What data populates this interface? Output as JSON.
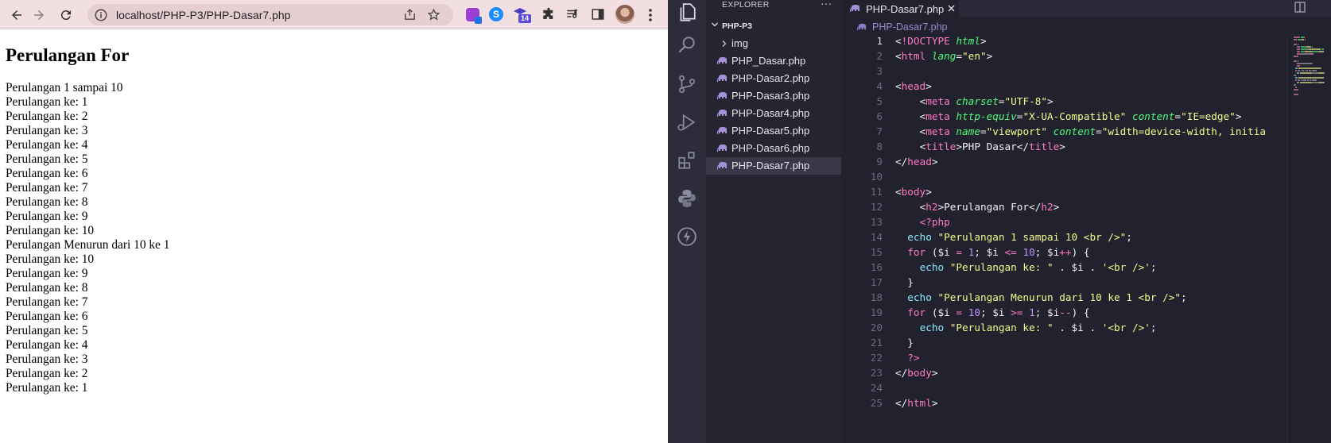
{
  "browser": {
    "url": "localhost/PHP-P3/PHP-Dasar7.php",
    "extension_badge": "14",
    "page": {
      "heading": "Perulangan For",
      "lines": [
        "Perulangan 1 sampai 10",
        "Perulangan ke: 1",
        "Perulangan ke: 2",
        "Perulangan ke: 3",
        "Perulangan ke: 4",
        "Perulangan ke: 5",
        "Perulangan ke: 6",
        "Perulangan ke: 7",
        "Perulangan ke: 8",
        "Perulangan ke: 9",
        "Perulangan ke: 10",
        "Perulangan Menurun dari 10 ke 1",
        "Perulangan ke: 10",
        "Perulangan ke: 9",
        "Perulangan ke: 8",
        "Perulangan ke: 7",
        "Perulangan ke: 6",
        "Perulangan ke: 5",
        "Perulangan ke: 4",
        "Perulangan ke: 3",
        "Perulangan ke: 2",
        "Perulangan ke: 1"
      ]
    }
  },
  "vscode": {
    "explorer_title": "EXPLORER",
    "explorer_more": "···",
    "project": "PHP-P3",
    "tree": [
      {
        "label": "img",
        "type": "folder"
      },
      {
        "label": "PHP_Dasar.php",
        "type": "php"
      },
      {
        "label": "PHP-Dasar2.php",
        "type": "php"
      },
      {
        "label": "PHP-Dasar3.php",
        "type": "php"
      },
      {
        "label": "PHP-Dasar4.php",
        "type": "php"
      },
      {
        "label": "PHP-Dasar5.php",
        "type": "php"
      },
      {
        "label": "PHP-Dasar6.php",
        "type": "php"
      },
      {
        "label": "PHP-Dasar7.php",
        "type": "php",
        "selected": true
      }
    ],
    "tab_label": "PHP-Dasar7.php",
    "breadcrumb": "PHP-Dasar7.php",
    "current_line": 1,
    "code_lines": [
      {
        "n": "1",
        "tokens": [
          [
            "pun",
            "<"
          ],
          [
            "bang",
            "!"
          ],
          [
            "tag",
            "DOCTYPE"
          ],
          [
            "txt",
            " "
          ],
          [
            "attr",
            "html"
          ],
          [
            "pun",
            ">"
          ]
        ]
      },
      {
        "n": "2",
        "tokens": [
          [
            "pun",
            "<"
          ],
          [
            "tag",
            "html"
          ],
          [
            "txt",
            " "
          ],
          [
            "attr",
            "lang"
          ],
          [
            "pun",
            "="
          ],
          [
            "str",
            "\"en\""
          ],
          [
            "pun",
            ">"
          ]
        ]
      },
      {
        "n": "3",
        "tokens": []
      },
      {
        "n": "4",
        "tokens": [
          [
            "pun",
            "<"
          ],
          [
            "tag",
            "head"
          ],
          [
            "pun",
            ">"
          ]
        ]
      },
      {
        "n": "5",
        "tokens": [
          [
            "txt",
            "    "
          ],
          [
            "pun",
            "<"
          ],
          [
            "tag",
            "meta"
          ],
          [
            "txt",
            " "
          ],
          [
            "attr",
            "charset"
          ],
          [
            "pun",
            "="
          ],
          [
            "str",
            "\"UTF-8\""
          ],
          [
            "pun",
            ">"
          ]
        ]
      },
      {
        "n": "6",
        "tokens": [
          [
            "txt",
            "    "
          ],
          [
            "pun",
            "<"
          ],
          [
            "tag",
            "meta"
          ],
          [
            "txt",
            " "
          ],
          [
            "attr",
            "http-equiv"
          ],
          [
            "pun",
            "="
          ],
          [
            "str",
            "\"X-UA-Compatible\""
          ],
          [
            "txt",
            " "
          ],
          [
            "attr",
            "content"
          ],
          [
            "pun",
            "="
          ],
          [
            "str",
            "\"IE=edge\""
          ],
          [
            "pun",
            ">"
          ]
        ]
      },
      {
        "n": "7",
        "tokens": [
          [
            "txt",
            "    "
          ],
          [
            "pun",
            "<"
          ],
          [
            "tag",
            "meta"
          ],
          [
            "txt",
            " "
          ],
          [
            "attr",
            "name"
          ],
          [
            "pun",
            "="
          ],
          [
            "str",
            "\"viewport\""
          ],
          [
            "txt",
            " "
          ],
          [
            "attr",
            "content"
          ],
          [
            "pun",
            "="
          ],
          [
            "str",
            "\"width=device-width, initia"
          ]
        ]
      },
      {
        "n": "8",
        "tokens": [
          [
            "txt",
            "    "
          ],
          [
            "pun",
            "<"
          ],
          [
            "tag",
            "title"
          ],
          [
            "pun",
            ">"
          ],
          [
            "txt",
            "PHP Dasar"
          ],
          [
            "pun",
            "</"
          ],
          [
            "tag",
            "title"
          ],
          [
            "pun",
            ">"
          ]
        ]
      },
      {
        "n": "9",
        "tokens": [
          [
            "pun",
            "</"
          ],
          [
            "tag",
            "head"
          ],
          [
            "pun",
            ">"
          ]
        ]
      },
      {
        "n": "10",
        "tokens": []
      },
      {
        "n": "11",
        "tokens": [
          [
            "pun",
            "<"
          ],
          [
            "tag",
            "body"
          ],
          [
            "pun",
            ">"
          ]
        ]
      },
      {
        "n": "12",
        "tokens": [
          [
            "txt",
            "    "
          ],
          [
            "pun",
            "<"
          ],
          [
            "tag",
            "h2"
          ],
          [
            "pun",
            ">"
          ],
          [
            "txt",
            "Perulangan For"
          ],
          [
            "pun",
            "</"
          ],
          [
            "tag",
            "h2"
          ],
          [
            "pun",
            ">"
          ]
        ]
      },
      {
        "n": "13",
        "tokens": [
          [
            "txt",
            "    "
          ],
          [
            "kw",
            "<?php"
          ]
        ]
      },
      {
        "n": "14",
        "tokens": [
          [
            "txt",
            "  "
          ],
          [
            "fn",
            "echo"
          ],
          [
            "txt",
            " "
          ],
          [
            "str",
            "\"Perulangan 1 sampai 10 <br />\""
          ],
          [
            "pun",
            ";"
          ]
        ]
      },
      {
        "n": "15",
        "tokens": [
          [
            "txt",
            "  "
          ],
          [
            "kw",
            "for"
          ],
          [
            "txt",
            " ("
          ],
          [
            "var",
            "$i"
          ],
          [
            "txt",
            " "
          ],
          [
            "op",
            "="
          ],
          [
            "txt",
            " "
          ],
          [
            "num",
            "1"
          ],
          [
            "pun",
            ";"
          ],
          [
            "txt",
            " "
          ],
          [
            "var",
            "$i"
          ],
          [
            "txt",
            " "
          ],
          [
            "op",
            "<="
          ],
          [
            "txt",
            " "
          ],
          [
            "num",
            "10"
          ],
          [
            "pun",
            ";"
          ],
          [
            "txt",
            " "
          ],
          [
            "var",
            "$i"
          ],
          [
            "op",
            "++"
          ],
          [
            "txt",
            ") {"
          ]
        ]
      },
      {
        "n": "16",
        "tokens": [
          [
            "txt",
            "    "
          ],
          [
            "fn",
            "echo"
          ],
          [
            "txt",
            " "
          ],
          [
            "str",
            "\"Perulangan ke: \""
          ],
          [
            "txt",
            " . "
          ],
          [
            "var",
            "$i"
          ],
          [
            "txt",
            " . "
          ],
          [
            "str",
            "'<br />'"
          ],
          [
            "pun",
            ";"
          ]
        ]
      },
      {
        "n": "17",
        "tokens": [
          [
            "txt",
            "  }"
          ]
        ]
      },
      {
        "n": "18",
        "tokens": [
          [
            "txt",
            "  "
          ],
          [
            "fn",
            "echo"
          ],
          [
            "txt",
            " "
          ],
          [
            "str",
            "\"Perulangan Menurun dari 10 ke 1 <br />\""
          ],
          [
            "pun",
            ";"
          ]
        ]
      },
      {
        "n": "19",
        "tokens": [
          [
            "txt",
            "  "
          ],
          [
            "kw",
            "for"
          ],
          [
            "txt",
            " ("
          ],
          [
            "var",
            "$i"
          ],
          [
            "txt",
            " "
          ],
          [
            "op",
            "="
          ],
          [
            "txt",
            " "
          ],
          [
            "num",
            "10"
          ],
          [
            "pun",
            ";"
          ],
          [
            "txt",
            " "
          ],
          [
            "var",
            "$i"
          ],
          [
            "txt",
            " "
          ],
          [
            "op",
            ">="
          ],
          [
            "txt",
            " "
          ],
          [
            "num",
            "1"
          ],
          [
            "pun",
            ";"
          ],
          [
            "txt",
            " "
          ],
          [
            "var",
            "$i"
          ],
          [
            "op",
            "--"
          ],
          [
            "txt",
            ") {"
          ]
        ]
      },
      {
        "n": "20",
        "tokens": [
          [
            "txt",
            "    "
          ],
          [
            "fn",
            "echo"
          ],
          [
            "txt",
            " "
          ],
          [
            "str",
            "\"Perulangan ke: \""
          ],
          [
            "txt",
            " . "
          ],
          [
            "var",
            "$i"
          ],
          [
            "txt",
            " . "
          ],
          [
            "str",
            "'<br />'"
          ],
          [
            "pun",
            ";"
          ]
        ]
      },
      {
        "n": "21",
        "tokens": [
          [
            "txt",
            "  }"
          ]
        ]
      },
      {
        "n": "22",
        "tokens": [
          [
            "txt",
            "  "
          ],
          [
            "kw",
            "?>"
          ]
        ]
      },
      {
        "n": "23",
        "tokens": [
          [
            "pun",
            "</"
          ],
          [
            "tag",
            "body"
          ],
          [
            "pun",
            ">"
          ]
        ]
      },
      {
        "n": "24",
        "tokens": []
      },
      {
        "n": "25",
        "tokens": [
          [
            "pun",
            "</"
          ],
          [
            "tag",
            "html"
          ],
          [
            "pun",
            ">"
          ]
        ]
      }
    ]
  },
  "colors": {
    "browser_toolbar": "#f2dfe2",
    "vscode_bg": "#22222e",
    "tag": "#ff79c6",
    "attr": "#50fa7b",
    "string": "#f1fa8c",
    "number": "#bd93f9",
    "function": "#8be9fd",
    "php_icon": "#a58fd9"
  }
}
